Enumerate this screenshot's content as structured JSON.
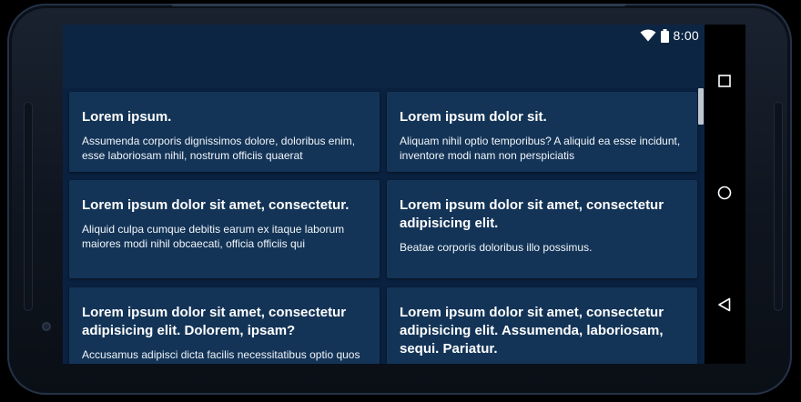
{
  "status_bar": {
    "time": "8:00",
    "icons": [
      "wifi-icon",
      "battery-icon"
    ]
  },
  "cards": [
    {
      "title": "Lorem ipsum.",
      "body": "Assumenda corporis dignissimos dolore, doloribus enim, esse laboriosam nihil, nostrum officiis quaerat"
    },
    {
      "title": "Lorem ipsum dolor sit.",
      "body": "Aliquam nihil optio temporibus? A aliquid ea esse incidunt, inventore modi nam non perspiciatis"
    },
    {
      "title": "Lorem ipsum dolor sit amet, consectetur.",
      "body": "Aliquid culpa cumque debitis earum ex itaque laborum maiores modi nihil obcaecati, officia officiis qui"
    },
    {
      "title": "Lorem ipsum dolor sit amet, consectetur adipisicing elit.",
      "body": "Beatae corporis doloribus illo possimus."
    },
    {
      "title": "Lorem ipsum dolor sit amet, consectetur adipisicing elit. Dolorem, ipsam?",
      "body": "Accusamus adipisci dicta facilis necessitatibus optio quos sapiente? Accusamus adipisci cupiditate atque"
    },
    {
      "title": "Lorem ipsum dolor sit amet, consectetur adipisicing elit. Assumenda, laboriosam, sequi. Pariatur.",
      "body": ""
    }
  ],
  "nav_bar": {
    "buttons": [
      "recents-square-icon",
      "home-circle-icon",
      "back-triangle-icon"
    ]
  },
  "colors": {
    "app_bar": "#0c2543",
    "content_bg": "#0a2140",
    "card_bg": "#133457",
    "text": "#ffffff",
    "nav_bar": "#000000",
    "device_frame": "#1a2230"
  }
}
